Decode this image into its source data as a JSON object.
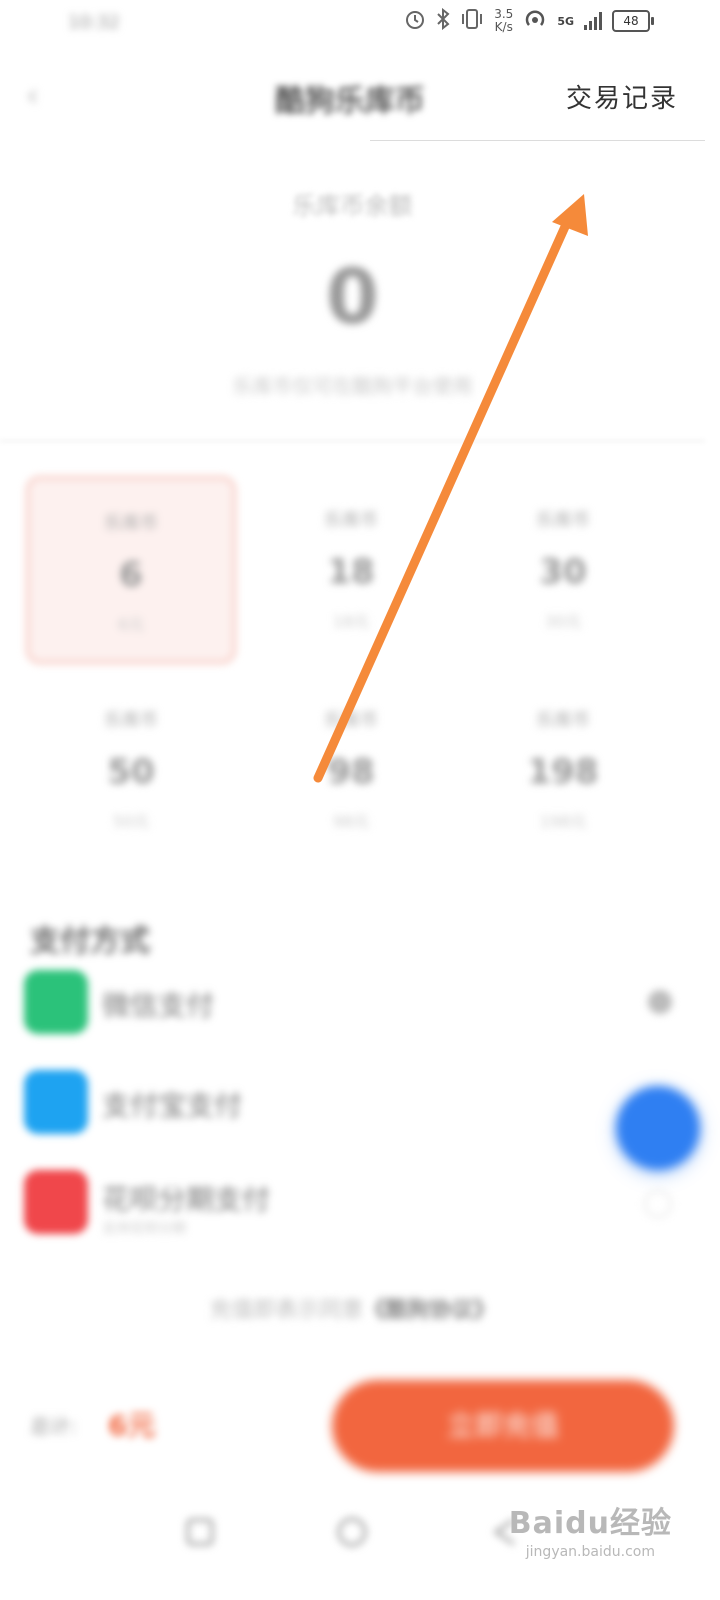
{
  "status_bar": {
    "time": "10:32",
    "net_speed_value": "3.5",
    "net_speed_unit": "K/s",
    "network": "5G",
    "battery": "48",
    "icons": [
      "alarm-icon",
      "bluetooth-icon",
      "vibrate-icon",
      "hotspot-icon",
      "signal-icon",
      "battery-icon"
    ]
  },
  "header": {
    "title": "酷狗乐库币",
    "records_label": "交易记录"
  },
  "balance": {
    "label": "乐库币余额",
    "value": "0",
    "note": "乐库币仅可在酷狗平台使用"
  },
  "packages": [
    {
      "top": "乐库币",
      "amount": "6",
      "price": "6元",
      "selected": true
    },
    {
      "top": "乐库币",
      "amount": "18",
      "price": "18元",
      "selected": false
    },
    {
      "top": "乐库币",
      "amount": "30",
      "price": "30元",
      "selected": false
    },
    {
      "top": "乐库币",
      "amount": "50",
      "price": "50元",
      "selected": false
    },
    {
      "top": "乐库币",
      "amount": "98",
      "price": "98元",
      "selected": false
    },
    {
      "top": "乐库币",
      "amount": "198",
      "price": "198元",
      "selected": false
    }
  ],
  "payment": {
    "title": "支付方式",
    "methods": [
      {
        "name": "微信支付",
        "sub": "",
        "color": "#2bc27a",
        "icon": "wechat-icon"
      },
      {
        "name": "支付宝支付",
        "sub": "",
        "color": "#1ea3f1",
        "icon": "alipay-icon"
      },
      {
        "name": "花呗分期支付",
        "sub": "支持花呗分期",
        "color": "#f0474b",
        "icon": "huabei-icon"
      }
    ]
  },
  "agreement": {
    "prefix": "充值即表示同意",
    "link": "《酷狗协议》"
  },
  "footer": {
    "total_label": "总计:",
    "total_value": "6元",
    "pay_button": "立即充值"
  },
  "watermark": {
    "main": "Baidu经验",
    "sub": "jingyan.baidu.com"
  },
  "colors": {
    "accent": "#f2663f",
    "arrow": "#f58a3a",
    "float_button": "#2f7ff2"
  }
}
